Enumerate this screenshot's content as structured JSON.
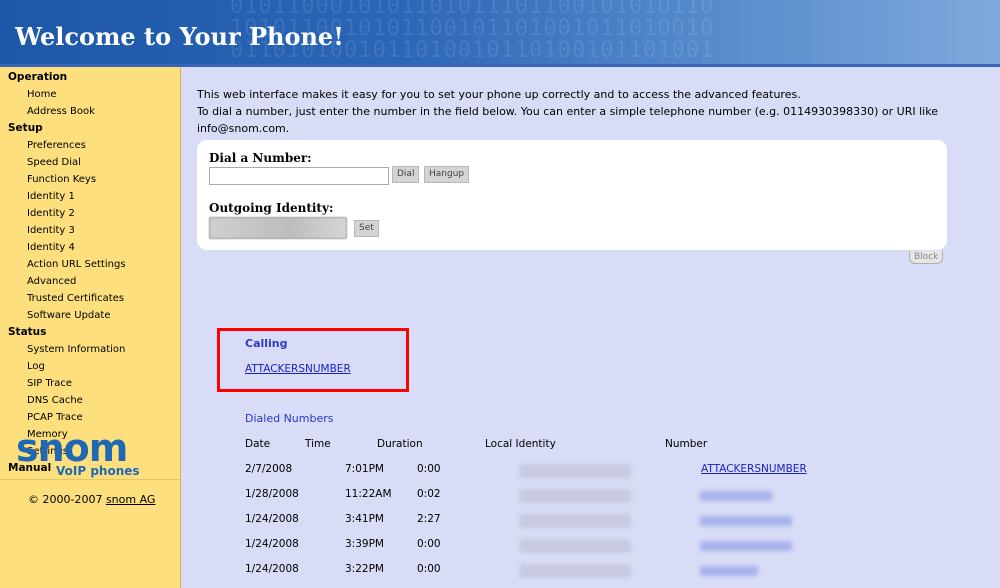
{
  "header": {
    "title": "Welcome to Your Phone!",
    "bits_decoration": "0101100010101101011101100101010110\n1010110010101100101101001011010010\n0110101001011010010110100101101001"
  },
  "sidebar": {
    "sections": [
      {
        "title": "Operation",
        "items": [
          "Home",
          "Address Book"
        ]
      },
      {
        "title": "Setup",
        "items": [
          "Preferences",
          "Speed Dial",
          "Function Keys",
          "Identity 1",
          "Identity 2",
          "Identity 3",
          "Identity 4",
          "Action URL Settings",
          "Advanced",
          "Trusted Certificates",
          "Software Update"
        ]
      },
      {
        "title": "Status",
        "items": [
          "System Information",
          "Log",
          "SIP Trace",
          "DNS Cache",
          "PCAP Trace",
          "Memory",
          "Settings"
        ]
      },
      {
        "title": "Manual",
        "items": []
      }
    ],
    "logo_word": "snom",
    "logo_sub": "VoIP phones",
    "copyright_prefix": "© 2000-2007 ",
    "copyright_link": "snom AG"
  },
  "intro": {
    "line1": "This web interface makes it easy for you to set your phone up correctly and to access the advanced features.",
    "line2": "To dial a number, just enter the number in the field below. You can enter a simple telephone number (e.g. 0114930398330) or URI like info@snom.com."
  },
  "dial": {
    "label": "Dial a Number:",
    "input_value": "",
    "dial_button": "Dial",
    "hangup_button": "Hangup",
    "identity_label": "Outgoing Identity:",
    "set_button": "Set",
    "block_button": "Block"
  },
  "calling": {
    "title": "Calling",
    "number": "ATTACKERSNUMBER"
  },
  "dialed": {
    "title": "Dialed Numbers",
    "columns": [
      "Date",
      "Time",
      "Duration",
      "Local Identity",
      "Number"
    ],
    "rows": [
      {
        "date": "2/7/2008",
        "time": "7:01PM",
        "duration": "0:00",
        "number": "ATTACKERSNUMBER"
      },
      {
        "date": "1/28/2008",
        "time": "11:22AM",
        "duration": "0:02",
        "number": ""
      },
      {
        "date": "1/24/2008",
        "time": "3:41PM",
        "duration": "2:27",
        "number": ""
      },
      {
        "date": "1/24/2008",
        "time": "3:39PM",
        "duration": "0:00",
        "number": ""
      },
      {
        "date": "1/24/2008",
        "time": "3:22PM",
        "duration": "0:00",
        "number": ""
      }
    ]
  },
  "colors": {
    "header_blue": "#2b66b6",
    "sidebar_bg": "#fddf7d",
    "page_bg": "#d8dcf6",
    "link": "#1a22c4",
    "highlight_red": "#ff0000",
    "brand": "#1f68b3"
  }
}
